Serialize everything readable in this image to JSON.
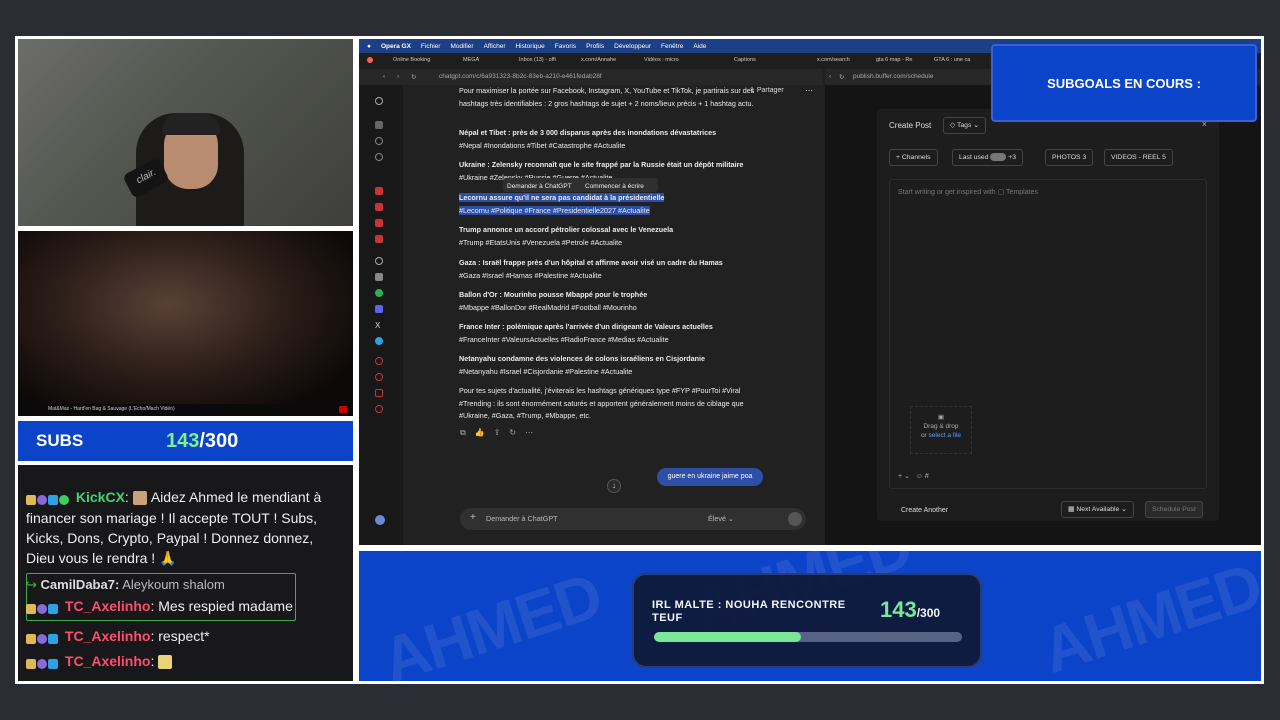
{
  "subs": {
    "label": "SUBS",
    "current": "143",
    "total": "/300",
    "progress": 0.477
  },
  "webcam": {
    "mic_brand": "clair."
  },
  "video": {
    "caption_bar": "Mat&Max - Hard'en Bag & Sauvage (L'Echo/Mach Vidéo)"
  },
  "chat": {
    "messages": [
      {
        "user": "KickCX",
        "text": "Aidez Ahmed le mendiant à financer son mariage ! Il accepte TOUT ! Subs, Kicks, Dons, Crypto, Paypal ! Donnez donnez, Dieu vous le rendra !",
        "user_color": "#43d36f"
      },
      {
        "reply_to": "CamilDaba7:",
        "reply_text": "Aleykoum shalom",
        "user": "TC_Axelinho",
        "text": ": Mes respied madame",
        "user_color": "#ff4d6d"
      },
      {
        "user": "TC_Axelinho",
        "text": ": respect*",
        "user_color": "#ff4d6d"
      },
      {
        "user": "TC_Axelinho",
        "text": ":",
        "user_color": "#ff4d6d"
      }
    ]
  },
  "macbar": {
    "app": "Opera GX",
    "menus": [
      "Fichier",
      "Modifier",
      "Afficher",
      "Historique",
      "Favoris",
      "Profils",
      "Développeur",
      "Fenêtre",
      "Aide"
    ]
  },
  "tabs": [
    "Online Booking",
    "MEGA",
    "Inbox (13) - offi",
    "x.com/Annahe",
    "Vidéos : micro",
    "Captions",
    "x.com/search",
    "gta 6 map - Re",
    "GTA 6 : une ca"
  ],
  "gpt": {
    "url": "chatgpt.com/c/6a931323-8b2c-83eb-a210-e461fedab28f",
    "share": "Partager",
    "intro": "Pour maximiser la portée sur Facebook, Instagram, X, YouTube et TikTok, je partirais sur des hashtags très identifiables : 2 gros hashtags de sujet + 2 noms/lieux précis + 1 hashtag actu.",
    "items": [
      {
        "title": "Népal et Tibet : près de 3 000 disparus après des inondations dévastatrices",
        "tags": "#Nepal #Inondations #Tibet #Catastrophe #Actualite"
      },
      {
        "title": "Ukraine : Zelensky reconnaît que le site frappé par la Russie était un dépôt militaire",
        "tags": "#Ukraine #Zelensky #Russie #Guerre #Actualite"
      },
      {
        "title": "Lecornu assure qu'il ne sera pas candidat à la présidentielle",
        "tags": "#Lecornu #Politique #France #Presidentielle2027 #Actualite"
      },
      {
        "title": "Trump annonce un accord pétrolier colossal avec le Venezuela",
        "tags": "#Trump #EtatsUnis #Venezuela #Petrole #Actualite"
      },
      {
        "title": "Gaza : Israël frappe près d'un hôpital et affirme avoir visé un cadre du Hamas",
        "tags": "#Gaza #Israel #Hamas #Palestine #Actualite"
      },
      {
        "title": "Ballon d'Or : Mourinho pousse Mbappé pour le trophée",
        "tags": "#Mbappe #BallonDor #RealMadrid #Football #Mourinho"
      },
      {
        "title": "France Inter : polémique après l'arrivée d'un dirigeant de Valeurs actuelles",
        "tags": "#FranceInter #ValeursActuelles #RadioFrance #Medias #Actualite"
      },
      {
        "title": "Netanyahu condamne des violences de colons israéliens en Cisjordanie",
        "tags": "#Netanyahu #Israel #Cisjordanie #Palestine #Actualite"
      }
    ],
    "outro": "Pour tes sujets d'actualité, j'éviterais les hashtags génériques type #FYP #PourToi #Viral #Trending : ils sont énormément saturés et apportent généralement moins de ciblage que #Ukraine, #Gaza, #Trump, #Mbappe, etc.",
    "context_menu": [
      "Demander à ChatGPT",
      "Commencer à écrire"
    ],
    "user_bubble": "guere en ukraine jaime poa",
    "prompt_placeholder": "Demander à ChatGPT",
    "model": "Élevé"
  },
  "buffer": {
    "url": "publish.buffer.com/schedule",
    "title": "Create Post",
    "tags_btn": "Tags",
    "channels_btn": "Channels",
    "last_used": "Last used",
    "last_used_count": "+3",
    "photos": "PHOTOS",
    "photos_count": "3",
    "videos": "VIDEOS - REEL",
    "videos_count": "5",
    "editor_placeholder": "Start writing or get inspired with",
    "templates": "Templates",
    "drag_drop": "Drag & drop",
    "or": "or",
    "select_file": "select a file",
    "create_another": "Create Another",
    "next_available": "Next Available",
    "schedule_post": "Schedule Post"
  },
  "subgoals": {
    "label": "SUBGOALS EN COURS :"
  },
  "goal": {
    "title": "IRL MALTE : NOUHA RENCONTRE TEUF",
    "current": "143",
    "total": "/300",
    "progress": 0.477
  },
  "colors": {
    "brand_blue": "#0b43c9",
    "green": "#7ff093",
    "highlight": "#2b4fa8"
  }
}
